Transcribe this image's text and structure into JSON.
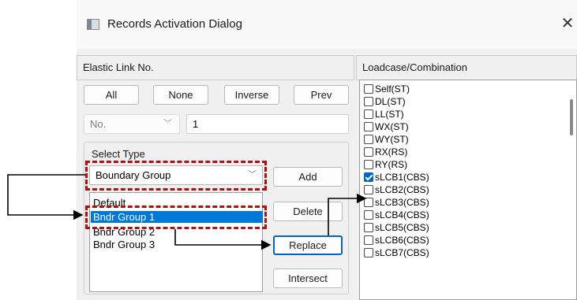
{
  "window": {
    "title": "Records Activation Dialog",
    "close_glyph": "✕"
  },
  "left_panel": {
    "header": "Elastic Link No.",
    "buttons": {
      "all": "All",
      "none": "None",
      "inverse": "Inverse",
      "prev": "Prev"
    },
    "no_combo": {
      "value": "No."
    },
    "number_field": {
      "value": "1"
    },
    "select_type": {
      "label": "Select Type",
      "selected": "Boundary Group",
      "add": "Add",
      "delete": "Delete",
      "replace": "Replace",
      "intersect": "Intersect",
      "list_items": [
        "Default",
        "Bndr Group 1",
        "Bndr Group 2",
        "Bndr Group 3"
      ],
      "selected_item": "Bndr Group 1"
    }
  },
  "right_panel": {
    "header": "Loadcase/Combination",
    "items": [
      {
        "label": "Self(ST)",
        "checked": false
      },
      {
        "label": "DL(ST)",
        "checked": false
      },
      {
        "label": "LL(ST)",
        "checked": false
      },
      {
        "label": "WX(ST)",
        "checked": false
      },
      {
        "label": "WY(ST)",
        "checked": false
      },
      {
        "label": "RX(RS)",
        "checked": false
      },
      {
        "label": "RY(RS)",
        "checked": false
      },
      {
        "label": "sLCB1(CBS)",
        "checked": true
      },
      {
        "label": "sLCB2(CBS)",
        "checked": false
      },
      {
        "label": "sLCB3(CBS)",
        "checked": false
      },
      {
        "label": "sLCB4(CBS)",
        "checked": false
      },
      {
        "label": "sLCB5(CBS)",
        "checked": false
      },
      {
        "label": "sLCB6(CBS)",
        "checked": false
      },
      {
        "label": "sLCB7(CBS)",
        "checked": false
      }
    ]
  },
  "annotation": {
    "highlight_color": "#b01010",
    "arrow_color": "#000000"
  },
  "colors": {
    "selection": "#0078d7",
    "checkbox_checked": "#0067c0"
  }
}
